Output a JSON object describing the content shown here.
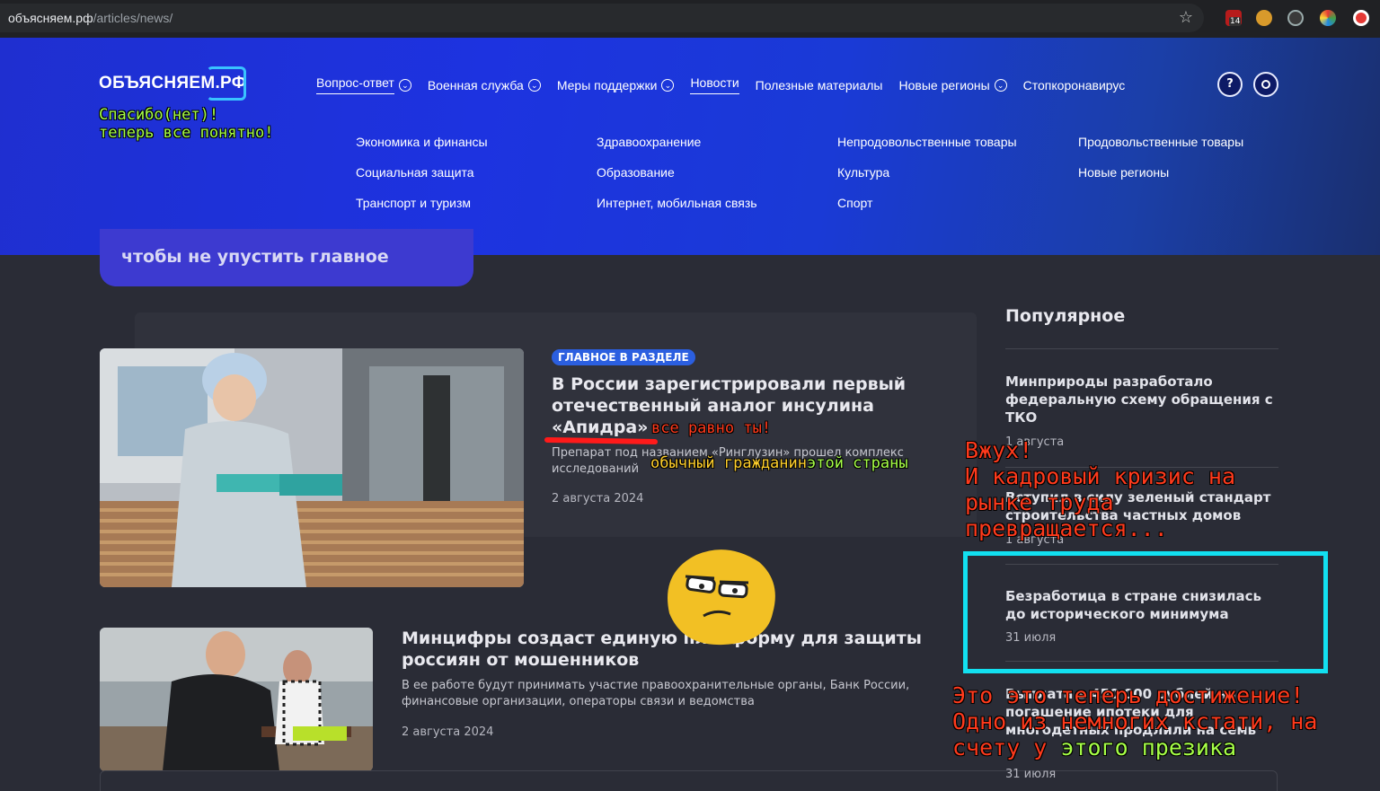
{
  "browser": {
    "url_host": "объясняем.рф",
    "url_path": "/articles/news/",
    "ext_badge": "14"
  },
  "header": {
    "logo": "ОБЪЯСНЯЕМ.РФ",
    "nav": [
      {
        "label": "Вопрос-ответ",
        "chevron": true,
        "active": true
      },
      {
        "label": "Военная служба",
        "chevron": true,
        "active": false
      },
      {
        "label": "Меры поддержки",
        "chevron": true,
        "active": false
      },
      {
        "label": "Новости",
        "chevron": false,
        "active": true
      },
      {
        "label": "Полезные материалы",
        "chevron": false,
        "active": false
      },
      {
        "label": "Новые регионы",
        "chevron": true,
        "active": false
      },
      {
        "label": "Стопкоронавирус",
        "chevron": false,
        "active": false
      }
    ],
    "help_icon": "?",
    "submenu": [
      "Экономика и финансы",
      "Здравоохранение",
      "Непродовольственные товары",
      "Продовольственные товары",
      "Социальная защита",
      "Образование",
      "Культура",
      "Новые регионы",
      "Транспорт и туризм",
      "Интернет, мобильная связь",
      "Спорт",
      ""
    ]
  },
  "cta": {
    "text": "чтобы не упустить главное"
  },
  "articles": [
    {
      "badge": "ГЛАВНОЕ В РАЗДЕЛЕ",
      "title": "В России зарегистрировали первый отечественный аналог инсулина «Апидра»",
      "description": "Препарат под названием «Ринглузин» прошел комплекс исследований",
      "date": "2 августа 2024"
    },
    {
      "title": "Минцифры создаст единую платформу для защиты россиян от мошенников",
      "description": "В ее работе будут принимать участие правоохранительные органы, Банк России, финансовые организации, операторы связи и ведомства",
      "date": "2 августа 2024"
    }
  ],
  "popular": {
    "title": "Популярное",
    "items": [
      {
        "title": "Минприроды разработало федеральную схему обращения с ТКО",
        "date": "1 августа"
      },
      {
        "title": "Вступил в силу зеленый стандарт строительства частных домов",
        "date": "1 августа"
      },
      {
        "title": "Безработица в стране снизилась до исторического минимума",
        "date": "31 июля"
      },
      {
        "title": "Выплата в 450 000 рублей на погашение ипотеки для многодетных продлили на семь",
        "date": "31 июля"
      }
    ]
  },
  "annotations": {
    "header_line1": "Спасибо(нет)!",
    "header_line2": "теперь все понятно!",
    "title_note": "все равно ты!",
    "desc_note_a": "обычный гражданин",
    "desc_note_b": "этой страны",
    "side_note": "Вжух!\nИ кадровый кризис на\nрынке труда\nпревращается...",
    "bottom_note_a": "Это это теперь достижение!\nОдно из немногих кстати, на\nсчету у ",
    "bottom_note_b": "этого презика"
  },
  "colors": {
    "header_blue": "#1d33e0",
    "accent_cyan": "#12e0f0",
    "annotation_red": "#ff3a1c",
    "annotation_green": "#a6ff47",
    "page_bg": "#2a2c36"
  }
}
